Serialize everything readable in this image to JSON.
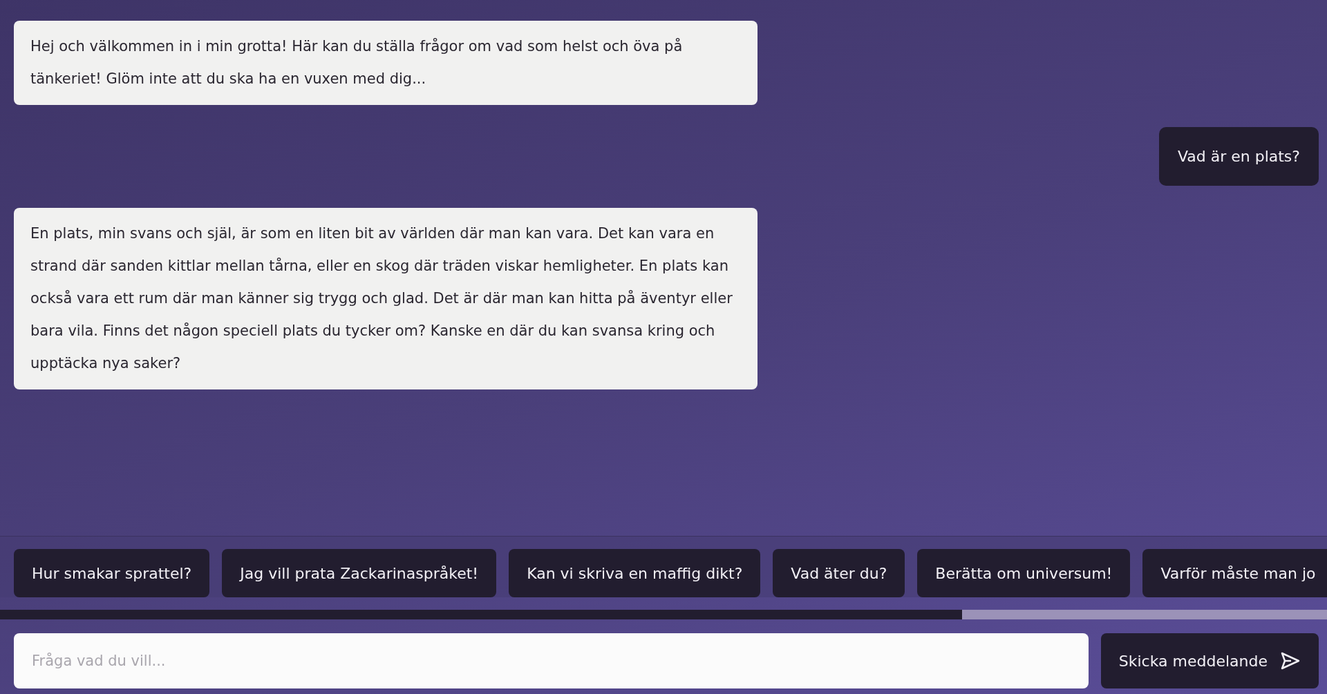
{
  "messages": [
    {
      "kind": "bot",
      "text": "Hej och välkommen in i min grotta! Här kan du ställa frågor om vad som helst och öva på tänkeriet! Glöm inte att du ska ha en vuxen med dig..."
    },
    {
      "kind": "user",
      "text": "Vad är en plats?"
    },
    {
      "kind": "bot",
      "text": "En plats, min svans och själ, är som en liten bit av världen där man kan vara. Det kan vara en strand där sanden kittlar mellan tårna, eller en skog där träden viskar hemligheter. En plats kan också vara ett rum där man känner sig trygg och glad. Det är där man kan hitta på äventyr eller bara vila. Finns det någon speciell plats du tycker om? Kanske en där du kan svansa kring och upptäcka nya saker?"
    }
  ],
  "suggestions": [
    "Hur smakar sprattel?",
    "Jag vill prata Zackarinaspråket!",
    "Kan vi skriva en maffig dikt?",
    "Vad äter du?",
    "Berätta om universum!",
    "Varför måste man jo"
  ],
  "input": {
    "placeholder": "Fråga vad du vill..."
  },
  "send_button": {
    "label": "Skicka meddelande"
  }
}
